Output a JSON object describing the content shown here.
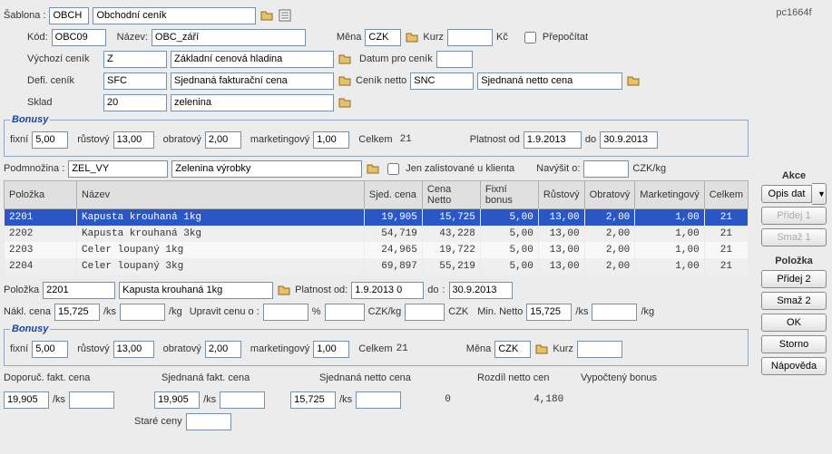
{
  "form_id": "pc1664f",
  "labels": {
    "sablona": "Šablona :",
    "kod": "Kód:",
    "nazev": "Název:",
    "mena": "Měna",
    "kurz": "Kurz",
    "kc": "Kč",
    "prepocitat": "Přepočítat",
    "vychozi_cenik": "Výchozí ceník",
    "datum_pro_cenik": "Datum pro ceník",
    "defi_cenik": "Defi. ceník",
    "cenik_netto": "Ceník netto",
    "sklad": "Sklad",
    "bonusy_group": "Bonusy",
    "fixni": "fixní",
    "rustovy": "růstový",
    "obratovy": "obratový",
    "marketingovy": "marketingový",
    "celkem": "Celkem",
    "platnost_od": "Platnost od",
    "do": "do",
    "podmnozina": "Podmnožina :",
    "jen_zalistovane": "Jen zalistované u klienta",
    "navysit_o": "Navýšit o:",
    "czk_kg": "CZK/kg",
    "polozka": "Položka",
    "platnost_od2": "Platnost od:",
    "nakl_cena": "Nákl. cena",
    "upravit_cenu_o": "Upravit cenu o :",
    "pct": "%",
    "czk": "CZK",
    "min_netto": "Min. Netto",
    "per_ks": "/ks",
    "per_kg": "/kg",
    "doporuc_fakt_cena": "Doporuč. fakt. cena",
    "sjednana_fakt_cena": "Sjednaná fakt. cena",
    "sjednana_netto_cena": "Sjednaná netto cena",
    "rozdil_netto_cen": "Rozdíl netto cen",
    "vypocteny_bonus": "Vypočtený bonus",
    "stare_ceny": "Staré ceny"
  },
  "template": {
    "code": "OBCH",
    "name": "Obchodní ceník"
  },
  "header": {
    "kod": "OBC09",
    "nazev": "OBC_září",
    "mena": "CZK",
    "kurz": "",
    "prepocitat": false
  },
  "vychozi_cenik": {
    "code": "Z",
    "name": "Základní cenová hladina"
  },
  "datum_pro_cenik": "",
  "defi_cenik": {
    "code": "SFC",
    "name": "Sjednaná fakturační cena"
  },
  "cenik_netto": {
    "code": "SNC",
    "name": "Sjednaná netto cena"
  },
  "sklad": {
    "code": "20",
    "name": "zelenina"
  },
  "bonusy_top": {
    "fixni": "5,00",
    "rustovy": "13,00",
    "obratovy": "2,00",
    "marketingovy": "1,00",
    "celkem": "21",
    "platnost_od": "1.9.2013",
    "platnost_do": "30.9.2013"
  },
  "podmnozina": {
    "code": "ZEL_VY",
    "name": "Zelenina výrobky"
  },
  "jen_zalistovane": false,
  "navysit_o": "",
  "grid": {
    "headers": [
      "Položka",
      "Název",
      "Sjed. cena",
      "Cena Netto",
      "Fixní bonus",
      "Růstový",
      "Obratový",
      "Marketingový",
      "Celkem"
    ],
    "rows": [
      {
        "polozka": "2201",
        "nazev": "Kapusta krouhaná 1kg",
        "sjed": "19,905",
        "netto": "15,725",
        "fixni": "5,00",
        "rust": "13,00",
        "obrat": "2,00",
        "mkt": "1,00",
        "celkem": "21",
        "selected": true
      },
      {
        "polozka": "2202",
        "nazev": "Kapusta krouhaná 3kg",
        "sjed": "54,719",
        "netto": "43,228",
        "fixni": "5,00",
        "rust": "13,00",
        "obrat": "2,00",
        "mkt": "1,00",
        "celkem": "21"
      },
      {
        "polozka": "2203",
        "nazev": "Celer loupaný 1kg",
        "sjed": "24,965",
        "netto": "19,722",
        "fixni": "5,00",
        "rust": "13,00",
        "obrat": "2,00",
        "mkt": "1,00",
        "celkem": "21"
      },
      {
        "polozka": "2204",
        "nazev": "Celer loupaný 3kg",
        "sjed": "69,897",
        "netto": "55,219",
        "fixni": "5,00",
        "rust": "13,00",
        "obrat": "2,00",
        "mkt": "1,00",
        "celkem": "21"
      }
    ]
  },
  "detail": {
    "polozka_code": "2201",
    "polozka_name": "Kapusta krouhaná 1kg",
    "platnost_od": "1.9.2013 0",
    "platnost_do": "30.9.2013",
    "nakl_cena": "15,725",
    "nakl_kg": "",
    "upravit_pct": "",
    "upravit_czkkg": "",
    "upravit_czk": "",
    "min_netto": "15,725",
    "min_netto_kg": ""
  },
  "bonusy_detail": {
    "fixni": "5,00",
    "rustovy": "13,00",
    "obratovy": "2,00",
    "marketingovy": "1,00",
    "celkem": "21",
    "mena": "CZK",
    "kurz": ""
  },
  "prices": {
    "doporuc": "19,905",
    "doporuc2": "",
    "sjednana_fakt": "19,905",
    "sjednana_fakt2": "",
    "sjednana_netto": "15,725",
    "sjednana_netto2": "",
    "rozdil": "0",
    "bonus": "4,180",
    "stare_ceny": ""
  },
  "side": {
    "akce_head": "Akce",
    "opis_dat": "Opis dat",
    "pridej1": "Přidej 1",
    "smaz1": "Smaž 1",
    "polozka_head": "Položka",
    "pridej2": "Přidej 2",
    "smaz2": "Smaž 2",
    "ok": "OK",
    "storno": "Storno",
    "napoveda": "Nápověda"
  }
}
